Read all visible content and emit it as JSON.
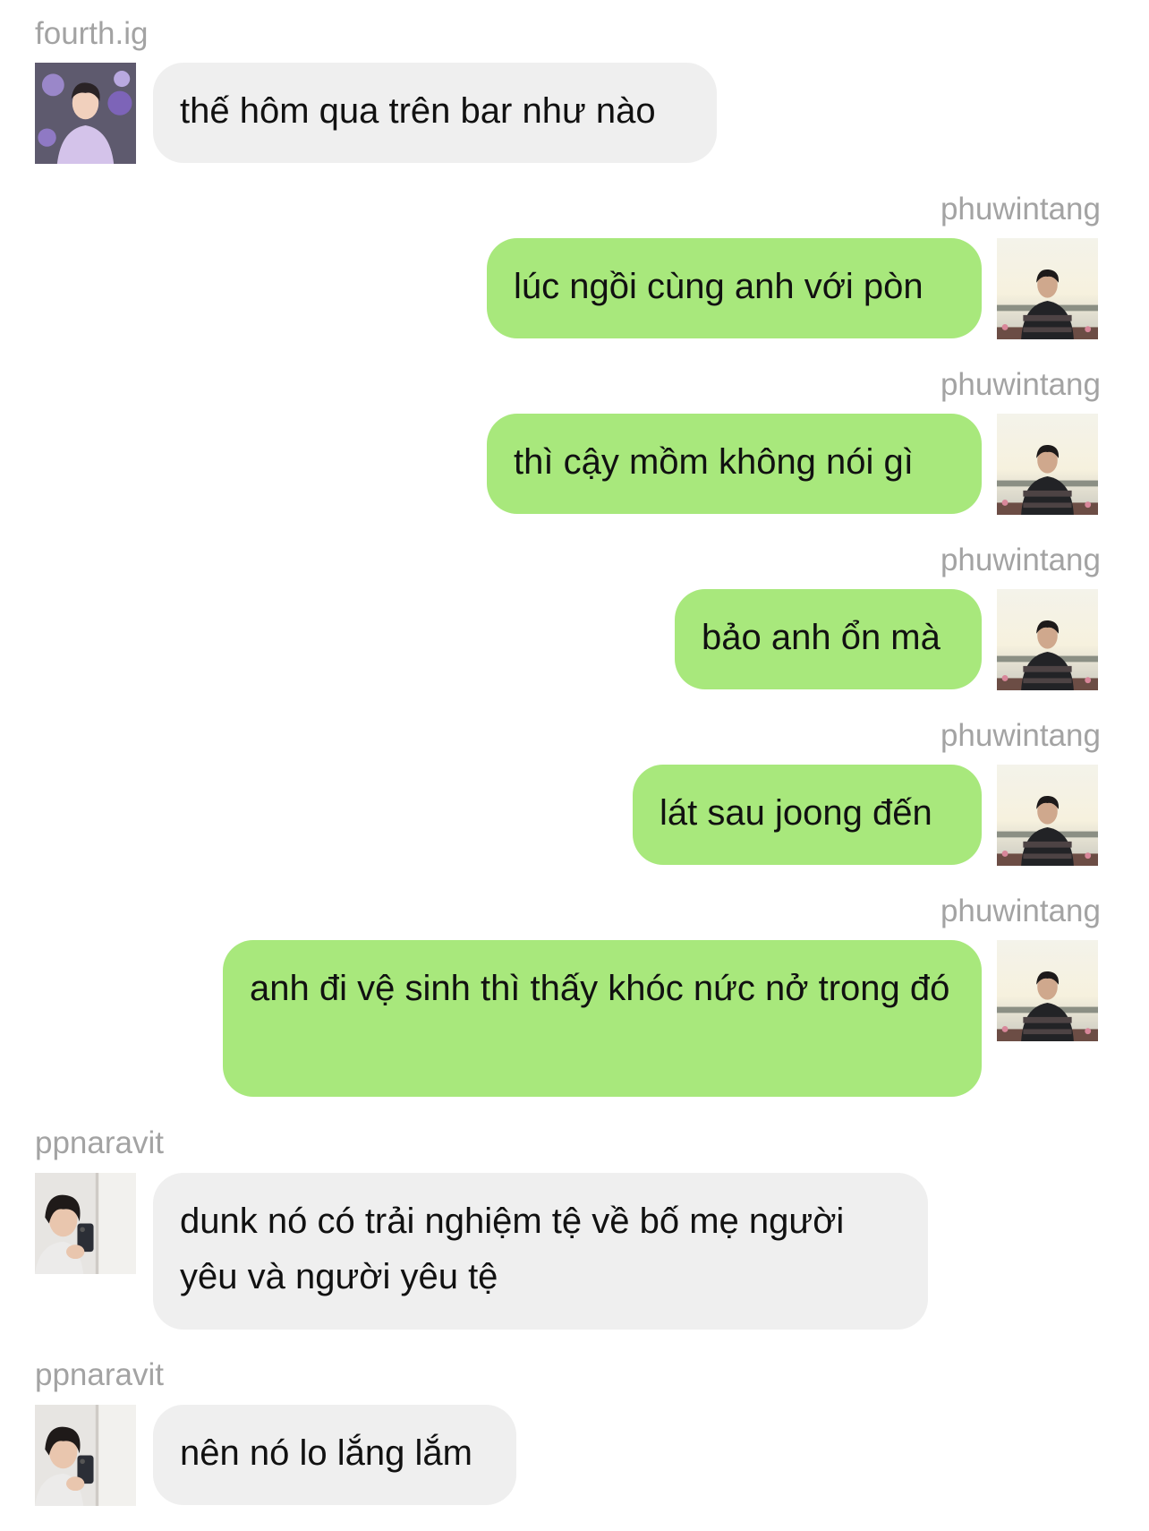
{
  "colors": {
    "incoming_bubble": "#efefef",
    "outgoing_bubble": "#a8e87c",
    "username_text": "#a3a3a3",
    "message_text": "#111111"
  },
  "messages": [
    {
      "sender": "fourth.ig",
      "side": "left",
      "avatar": "fourth-avatar",
      "text": "thế hôm qua trên bar như nào"
    },
    {
      "sender": "phuwintang",
      "side": "right",
      "avatar": "phuwin-avatar",
      "text": "lúc ngồi cùng anh với pòn"
    },
    {
      "sender": "phuwintang",
      "side": "right",
      "avatar": "phuwin-avatar",
      "text": "thì cậy mồm không nói gì"
    },
    {
      "sender": "phuwintang",
      "side": "right",
      "avatar": "phuwin-avatar",
      "text": "bảo anh ổn mà"
    },
    {
      "sender": "phuwintang",
      "side": "right",
      "avatar": "phuwin-avatar",
      "text": "lát sau joong đến"
    },
    {
      "sender": "phuwintang",
      "side": "right",
      "avatar": "phuwin-avatar",
      "text": "anh đi vệ sinh thì thấy khóc nức nở trong đó"
    },
    {
      "sender": "ppnaravit",
      "side": "left",
      "avatar": "pond-avatar",
      "text": "dunk nó có trải nghiệm tệ về bố mẹ người yêu và người yêu tệ"
    },
    {
      "sender": "ppnaravit",
      "side": "left",
      "avatar": "pond-avatar",
      "text": "nên nó lo lắng lắm"
    }
  ]
}
